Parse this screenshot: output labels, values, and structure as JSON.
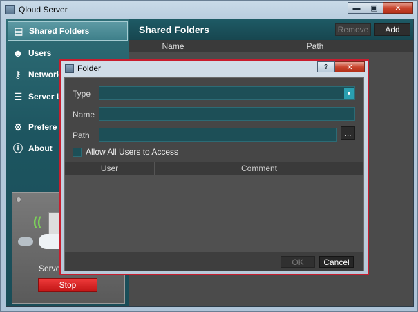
{
  "window": {
    "title": "Qloud Server",
    "minimize_icon": "minimize-icon",
    "maximize_icon": "maximize-icon",
    "close_icon": "close-icon",
    "minimize_glyph": "▬",
    "maximize_glyph": "▣",
    "close_glyph": "✕"
  },
  "sidebar": {
    "items": [
      {
        "label": "Shared Folders",
        "icon": "shared-folders-icon",
        "glyph": "▤",
        "active": true
      },
      {
        "label": "Users",
        "icon": "users-icon",
        "glyph": "☻"
      },
      {
        "label": "Network",
        "icon": "key-icon",
        "glyph": "⚷"
      },
      {
        "label": "Server L",
        "icon": "server-log-icon",
        "glyph": "☰"
      },
      {
        "label": "Prefere",
        "icon": "preferences-icon",
        "glyph": "⚙"
      },
      {
        "label": "About",
        "icon": "info-icon",
        "glyph": "ⓘ"
      }
    ],
    "server_panel": {
      "label": "Server",
      "stop_label": "Stop"
    }
  },
  "content": {
    "title": "Shared Folders",
    "remove_label": "Remove",
    "add_label": "Add",
    "columns": [
      "Name",
      "Path"
    ]
  },
  "dialog": {
    "title": "Folder",
    "help_glyph": "?",
    "close_glyph": "✕",
    "type_label": "Type",
    "type_value": "",
    "name_label": "Name",
    "name_value": "",
    "path_label": "Path",
    "path_value": "",
    "browse_label": "...",
    "allow_all_label": "Allow All Users to Access",
    "allow_all_checked": false,
    "user_columns": [
      "User",
      "Comment"
    ],
    "ok_label": "OK",
    "cancel_label": "Cancel"
  },
  "colors": {
    "accent": "#1d5560",
    "dialog_border": "#c81d2e",
    "stop": "#d42020"
  }
}
